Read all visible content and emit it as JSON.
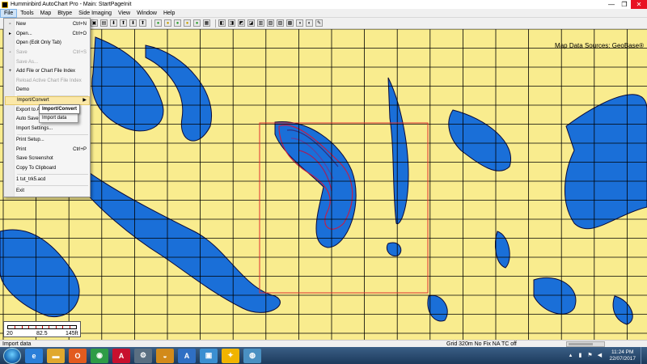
{
  "window": {
    "title": "Humminbird AutoChart Pro - Main: StartPageInit",
    "controls": {
      "minimize": "—",
      "maximize": "❐",
      "close": "✕"
    }
  },
  "menubar": {
    "items": [
      "File",
      "Tools",
      "Map",
      "Btype",
      "Side Imaging",
      "View",
      "Window",
      "Help"
    ]
  },
  "toolbar": {
    "icons": [
      "new-icon",
      "open-icon",
      "save-icon",
      "import-icon",
      "export-icon",
      "zoom-in-icon",
      "zoom-out-icon",
      "pan-icon",
      "color-icon",
      "layers-icon",
      "grid-icon",
      "settings-icon",
      "measure-icon",
      "draw-icon",
      "erase-icon",
      "waypoint-icon",
      "track-icon",
      "contour-icon",
      "depth-icon",
      "chart-icon",
      "print-icon",
      "info-icon",
      "help-icon"
    ]
  },
  "file_menu": {
    "items": [
      {
        "label": "New",
        "shortcut": "Ctrl+N",
        "disabled": false,
        "icon": "new-icon"
      },
      {
        "label": "Open...",
        "shortcut": "Ctrl+O",
        "disabled": false,
        "icon": "open-icon"
      },
      {
        "label": "Open (Edit Only Tab)",
        "shortcut": "",
        "disabled": false,
        "icon": ""
      },
      {
        "label": "Save",
        "shortcut": "Ctrl+S",
        "disabled": true,
        "icon": "save-icon"
      },
      {
        "label": "Save As...",
        "shortcut": "",
        "disabled": true,
        "icon": ""
      },
      {
        "label": "Add File or Chart File Index",
        "shortcut": "",
        "disabled": false,
        "icon": "add-icon"
      },
      {
        "label": "Reload Active Chart File Index",
        "shortcut": "",
        "disabled": true,
        "icon": ""
      },
      {
        "label": "Demo",
        "shortcut": "",
        "disabled": false,
        "icon": ""
      },
      {
        "label": "Import/Convert",
        "shortcut": "",
        "disabled": false,
        "icon": "",
        "highlighted": true,
        "submenu": true
      },
      {
        "label": "Export to A",
        "shortcut": "",
        "disabled": false,
        "icon": ""
      },
      {
        "label": "Auto Save",
        "shortcut": "",
        "disabled": false,
        "icon": ""
      },
      {
        "label": "Import Settings...",
        "shortcut": "",
        "disabled": false,
        "icon": ""
      },
      {
        "label": "Print Setup...",
        "shortcut": "",
        "disabled": false,
        "icon": ""
      },
      {
        "label": "Print",
        "shortcut": "Ctrl+P",
        "disabled": false,
        "icon": ""
      },
      {
        "label": "Save Screenshot",
        "shortcut": "",
        "disabled": false,
        "icon": ""
      },
      {
        "label": "Copy To Clipboard",
        "shortcut": "",
        "disabled": false,
        "icon": ""
      },
      {
        "label": "1 tut_trk5.acd",
        "shortcut": "",
        "disabled": false,
        "icon": ""
      },
      {
        "label": "Exit",
        "shortcut": "",
        "disabled": false,
        "icon": ""
      }
    ]
  },
  "submenu": {
    "tooltip": "Import/Convert",
    "items": [
      "Import data"
    ]
  },
  "map": {
    "source_label": "Map Data Sources: GeoBase®",
    "water_color": "#1a6fd8",
    "land_color": "#f9ec8e",
    "grid_color": "#000000",
    "selection_color": "#e03030"
  },
  "scale": {
    "labels": [
      "20",
      "82.5",
      "145ft"
    ]
  },
  "status": {
    "left": "Import data",
    "right": "Grid 320m No Fix    NA  TC off"
  },
  "taskbar": {
    "apps": [
      {
        "name": "ie-icon",
        "glyph": "e",
        "color": "#2b7fd9"
      },
      {
        "name": "explorer-icon",
        "glyph": "▬",
        "color": "#e0a82e"
      },
      {
        "name": "office-icon",
        "glyph": "O",
        "color": "#e25b1f"
      },
      {
        "name": "chrome-icon",
        "glyph": "◉",
        "color": "#2e9c46"
      },
      {
        "name": "acrobat-icon",
        "glyph": "A",
        "color": "#c8102e"
      },
      {
        "name": "tool-icon",
        "glyph": "⚙",
        "color": "#5a6f82"
      },
      {
        "name": "sailing-icon",
        "glyph": "◒",
        "color": "#d28a1a"
      },
      {
        "name": "text-icon",
        "glyph": "A",
        "color": "#2f6fc4"
      },
      {
        "name": "photo-icon",
        "glyph": "▣",
        "color": "#3b8fd1"
      },
      {
        "name": "autochart-icon",
        "glyph": "✦",
        "color": "#f0b400"
      },
      {
        "name": "network-icon",
        "glyph": "◍",
        "color": "#4a90c2"
      }
    ],
    "clock_time": "11:24 PM",
    "clock_date": "22/07/2017"
  }
}
